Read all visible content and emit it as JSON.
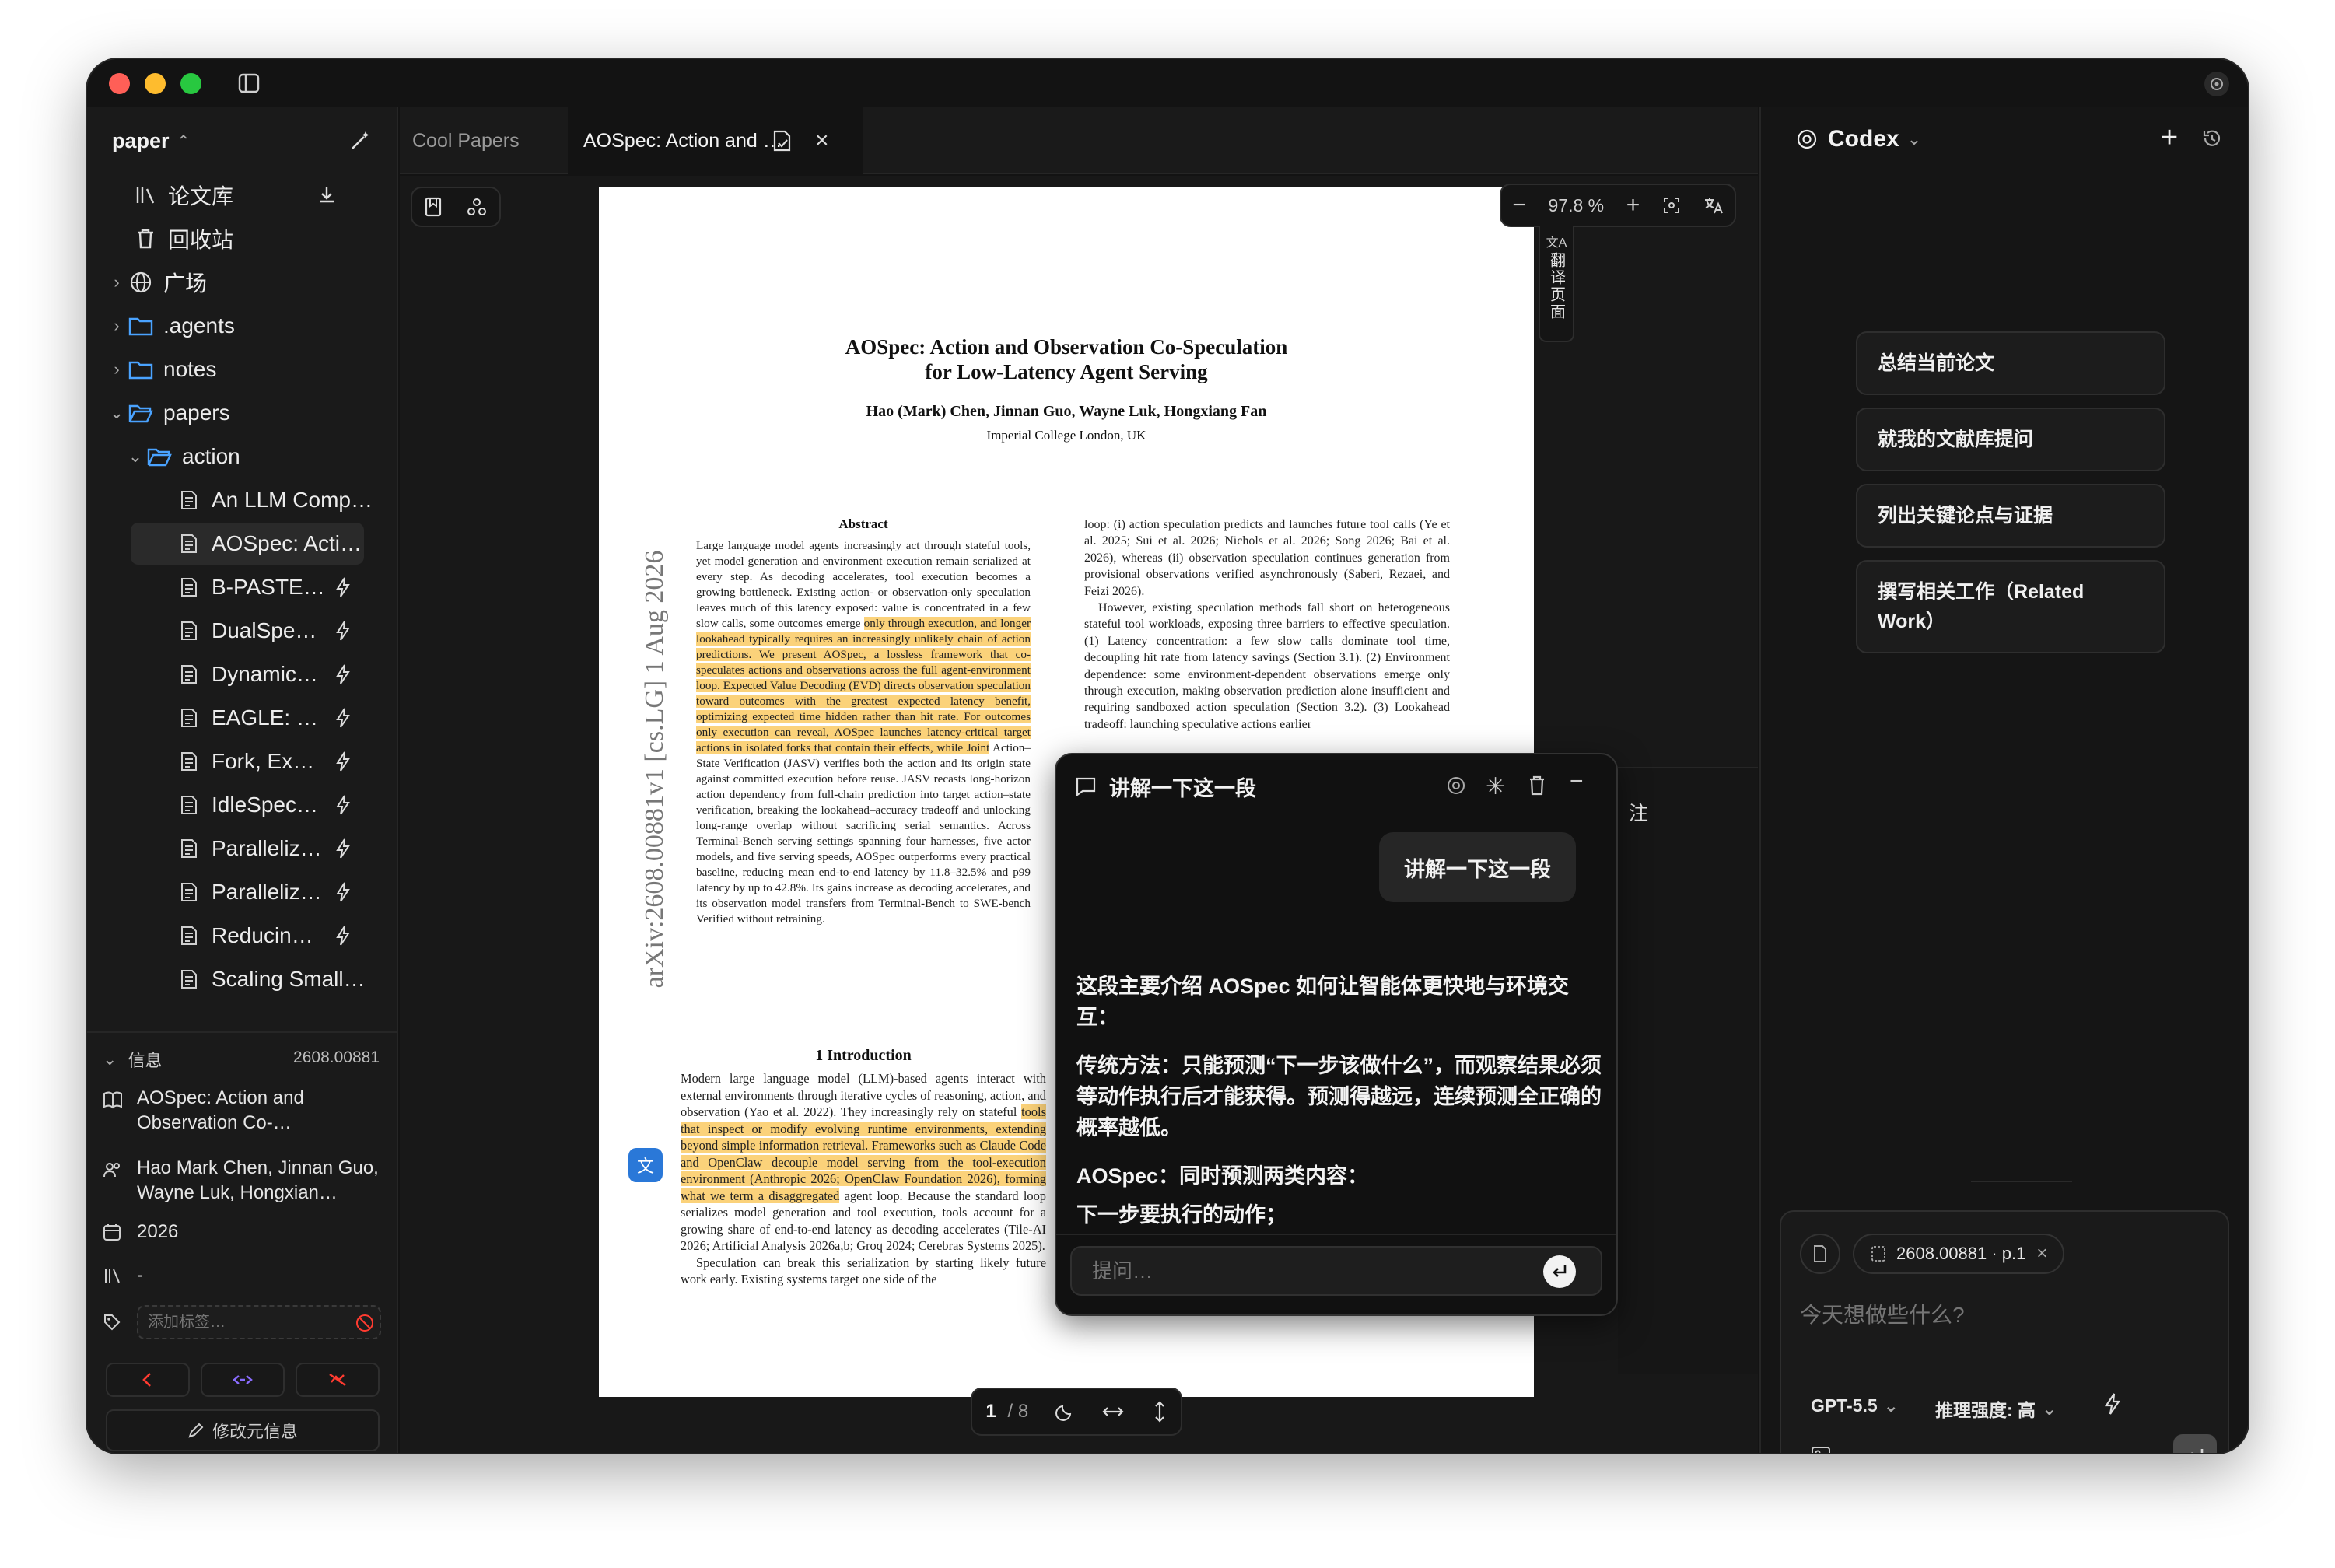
{
  "sidebar": {
    "title": "paper",
    "items": [
      {
        "label": "论文库",
        "icon": "library-icon"
      },
      {
        "label": "回收站",
        "icon": "trash-icon"
      },
      {
        "label": "广场",
        "icon": "globe-icon"
      },
      {
        "label": ".agents",
        "icon": "folder-icon"
      },
      {
        "label": "notes",
        "icon": "folder-icon"
      },
      {
        "label": "papers",
        "icon": "folder-open-icon"
      },
      {
        "label": "action",
        "icon": "folder-open-icon"
      },
      {
        "label": "An LLM Comp…",
        "icon": "document-icon"
      },
      {
        "label": "AOSpec: Acti…",
        "icon": "document-icon"
      },
      {
        "label": "B-PASTE…",
        "icon": "document-icon"
      },
      {
        "label": "DualSpe…",
        "icon": "document-icon"
      },
      {
        "label": "Dynamic…",
        "icon": "document-icon"
      },
      {
        "label": "EAGLE: …",
        "icon": "document-icon"
      },
      {
        "label": "Fork, Ex…",
        "icon": "document-icon"
      },
      {
        "label": "IdleSpec…",
        "icon": "document-icon"
      },
      {
        "label": "Paralleliz…",
        "icon": "document-icon"
      },
      {
        "label": "Paralleliz…",
        "icon": "document-icon"
      },
      {
        "label": "Reducin…",
        "icon": "document-icon"
      },
      {
        "label": "Scaling Small…",
        "icon": "document-icon"
      }
    ]
  },
  "info": {
    "header": "信息",
    "id": "2608.00881",
    "title": "AOSpec: Action and Observation Co-…",
    "authors": "Hao Mark Chen, Jinnan Guo, Wayne Luk, Hongxian…",
    "year": "2026",
    "venue": "-",
    "tag_placeholder": "添加标签…",
    "edit_label": "修改元信息"
  },
  "tabs": {
    "items": [
      {
        "label": "Cool Papers"
      },
      {
        "label": "AOSpec: Action and …"
      }
    ]
  },
  "viewer": {
    "zoom": "97.8 %",
    "translate_label": "翻译页面",
    "page": "1",
    "pages": "/ 8",
    "side_hint": "注"
  },
  "paper": {
    "title1": "AOSpec: Action and Observation Co-Speculation",
    "title2": "for Low-Latency Agent Serving",
    "authors": "Hao (Mark) Chen, Jinnan Guo, Wayne Luk, Hongxiang Fan",
    "affiliation": "Imperial College London, UK",
    "abstract_head": "Abstract",
    "abstract_a": "Large language model agents increasingly act through stateful tools, yet model generation and environment execution remain serialized at every step. As decoding accelerates, tool execution becomes a growing bottleneck. Existing action- or observation-only speculation leaves much of this latency exposed: value is concentrated in a few slow calls, some outcomes emerge ",
    "abstract_hl": "only through execution, and longer lookahead typically requires an increasingly unlikely chain of action predictions. We present AOSpec, a lossless framework that co-speculates actions and observations across the full agent-environment loop. Expected Value Decoding (EVD) directs observation speculation toward outcomes with the greatest expected latency benefit, optimizing expected time hidden rather than hit rate. For outcomes only execution can reveal, AOSpec launches latency-critical target actions in isolated forks that contain their effects, while Joint",
    "abstract_b": " Action–State Verification (JASV) verifies both the action and its origin state against committed execution before reuse. JASV recasts long-horizon action dependency from full-chain prediction into target action–state verification, breaking the lookahead–accuracy tradeoff and unlocking long-range overlap without sacrificing serial semantics. Across Terminal-Bench serving settings spanning four harnesses, five actor models, and five serving speeds, AOSpec outperforms every practical baseline, reducing mean end-to-end latency by 11.8–32.5% and p99 latency by up to 42.8%. Its gains increase as decoding accelerates, and its observation model transfers from Terminal-Bench to SWE-bench Verified without retraining.",
    "intro_head": "1   Introduction",
    "intro_a": "Modern large language model (LLM)-based agents interact with external environments through iterative cycles of reasoning, action, and observation (Yao et al. 2022). They increasingly rely on stateful ",
    "intro_hl": "tools that inspect or modify evolving runtime environments, extending beyond simple information retrieval. Frameworks such as Claude Code and OpenClaw decouple model serving from the tool-execution environment (Anthropic 2026; OpenClaw Foundation 2026), forming what we term a disaggregated",
    "intro_b": " agent loop. Because the standard loop serializes model generation and tool execution, tools account for a growing share of end-to-end latency as decoding accelerates (Tile-AI 2026; Artificial Analysis 2026a,b; Groq 2024; Cerebras Systems 2025).",
    "intro_c": "Speculation can break this serialization by starting likely future work early. Existing systems target one side of the",
    "right_col": "loop: (i) action speculation predicts and launches future tool calls (Ye et al. 2025; Sui et al. 2026; Nichols et al. 2026; Song 2026; Bai et al. 2026), whereas (ii) observation speculation continues generation from provisional observations verified asynchronously (Saberi, Rezaei, and Feizi 2026).",
    "right_col2": "However, existing speculation methods fall short on heterogeneous stateful tool workloads, exposing three barriers to effective speculation. (1) Latency concentration: a few slow calls dominate tool time, decoupling hit rate from latency savings (Section 3.1). (2) Environment dependence: some environment-dependent observations emerge only through execution, making observation prediction alone insufficient and requiring sandboxed action speculation (Section 3.2). (3) Lookahead tradeoff: launching speculative actions earlier",
    "arxiv": "arXiv:2608.00881v1  [cs.LG]  1 Aug 2026"
  },
  "popup": {
    "title": "讲解一下这一段",
    "user_msg": "讲解一下这一段",
    "p1": "这段主要介绍 AOSpec 如何让智能体更快地与环境交互：",
    "p2": "传统方法：只能预测“下一步该做什么”，而观察结果必须等动作执行后才能获得。预测得越远，连续预测全正确的概率越低。",
    "p3_bold": "AOSpec",
    "p3": "：同时预测两类内容：",
    "p4": "下一步要执行的动作；",
    "input_placeholder": "提问…"
  },
  "codex": {
    "title": "Codex",
    "suggestions": [
      "总结当前论文",
      "就我的文献库提问",
      "列出关键论点与证据",
      "撰写相关工作（Related Work）"
    ],
    "attachment": "2608.00881 · p.1",
    "placeholder": "今天想做些什么?",
    "model": "GPT-5.5",
    "reasoning": "推理强度: 高"
  }
}
